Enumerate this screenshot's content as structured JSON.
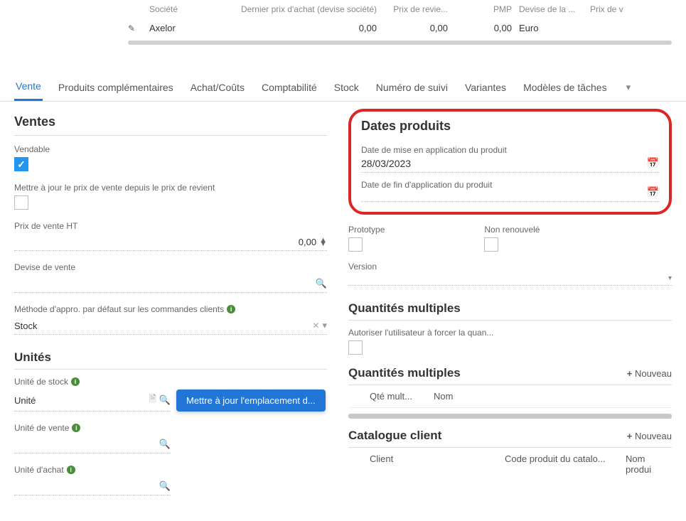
{
  "top_table": {
    "headers": {
      "societe": "Société",
      "dernier_prix": "Dernier prix d'achat (devise société)",
      "prix_revient": "Prix de revie...",
      "pmp": "PMP",
      "devise": "Devise de la ...",
      "prix_v": "Prix de v"
    },
    "row": {
      "company": "Axelor",
      "price1": "0,00",
      "price2": "0,00",
      "pmp": "0,00",
      "devise": "Euro"
    }
  },
  "tabs": {
    "vente": "Vente",
    "produits_comp": "Produits complémentaires",
    "achat_couts": "Achat/Coûts",
    "comptabilite": "Comptabilité",
    "stock": "Stock",
    "numero_suivi": "Numéro de suivi",
    "variantes": "Variantes",
    "modeles": "Modèles de tâches"
  },
  "sales": {
    "section": "Ventes",
    "vendable_label": "Vendable",
    "maj_prix_label": "Mettre à jour le prix de vente depuis le prix de revient",
    "prix_vente_ht_label": "Prix de vente HT",
    "prix_vente_ht_value": "0,00",
    "devise_vente_label": "Devise de vente",
    "methode_appro_label": "Méthode d'appro. par défaut sur les commandes clients",
    "methode_appro_value": "Stock"
  },
  "unites": {
    "section": "Unités",
    "stock_label": "Unité de stock",
    "stock_value": "Unité",
    "vente_label": "Unité de vente",
    "achat_label": "Unité d'achat",
    "tooltip": "Mettre à jour l'emplacement d..."
  },
  "dates": {
    "section": "Dates produits",
    "debut_label": "Date de mise en application du produit",
    "debut_value": "28/03/2023",
    "fin_label": "Date de fin d'application du produit"
  },
  "proto": {
    "prototype_label": "Prototype",
    "non_renouvele_label": "Non renouvelé",
    "version_label": "Version"
  },
  "qmult": {
    "section": "Quantités multiples",
    "autoriser_label": "Autoriser l'utilisateur à forcer la quan...",
    "sub_section": "Quantités multiples",
    "nouveau": "Nouveau",
    "col_qte": "Qté mult...",
    "col_nom": "Nom"
  },
  "catalog": {
    "section": "Catalogue client",
    "nouveau": "Nouveau",
    "col_client": "Client",
    "col_code": "Code produit du catalo...",
    "col_nom": "Nom produi"
  }
}
